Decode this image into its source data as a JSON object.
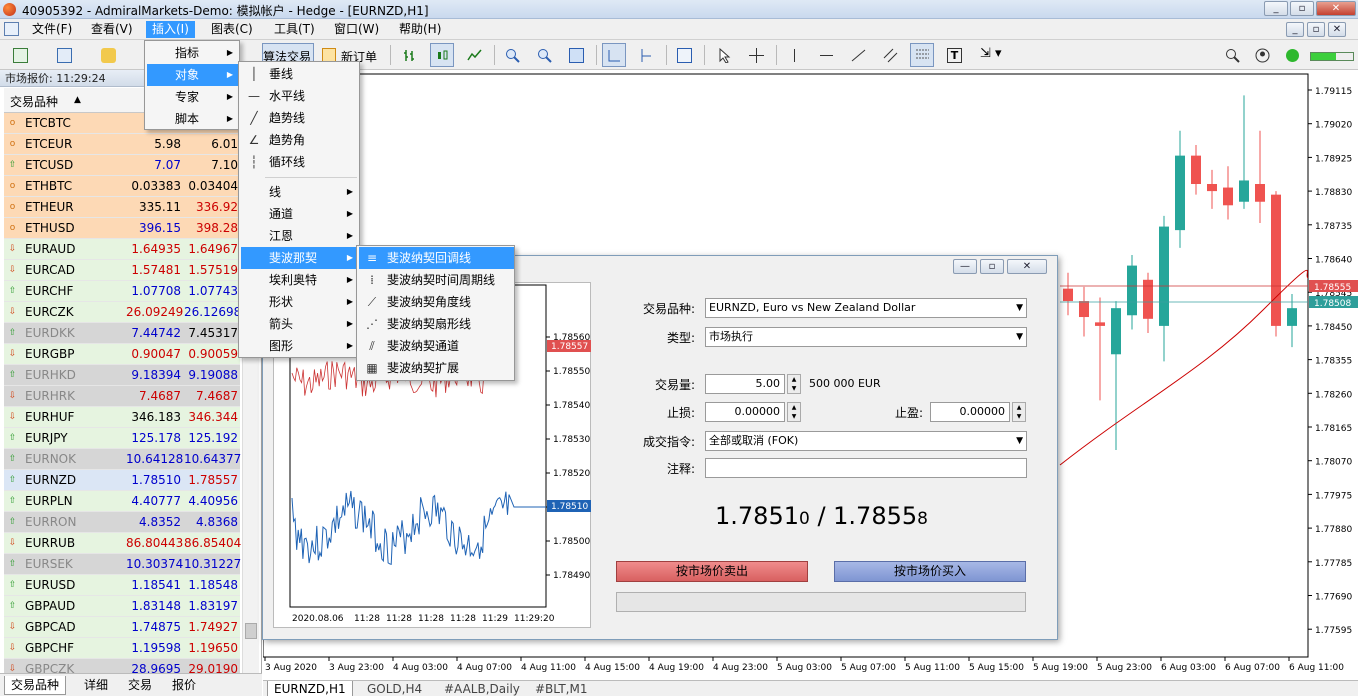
{
  "window": {
    "title": "40905392 - AdmiralMarkets-Demo: 模拟帐户 - Hedge - [EURNZD,H1]",
    "min": "_",
    "restore": "▫",
    "close": "✕"
  },
  "menubar": [
    "文件(F)",
    "查看(V)",
    "插入(I)",
    "图表(C)",
    "工具(T)",
    "窗口(W)",
    "帮助(H)"
  ],
  "toolbar": {
    "algo_label": "算法交易",
    "new_order_label": "新订单"
  },
  "market_watch": {
    "title": "市场报价: 11:29:24",
    "col_symbol": "交易品种",
    "rows": [
      {
        "symbol": "ETCBTC",
        "bid": "0.0",
        "ask": "",
        "bg": "#fdd9b5",
        "dir": "o"
      },
      {
        "symbol": "ETCEUR",
        "bid": "5.98",
        "ask": "6.01",
        "bg": "#fdd9b5",
        "dir": "o"
      },
      {
        "symbol": "ETCUSD",
        "bid": "7.07",
        "ask": "7.10",
        "bg": "#fdd9b5",
        "dir": "up",
        "bidc": "#0000cc"
      },
      {
        "symbol": "ETHBTC",
        "bid": "0.03383",
        "ask": "0.03404",
        "bg": "#fdd9b5",
        "dir": "o"
      },
      {
        "symbol": "ETHEUR",
        "bid": "335.11",
        "ask": "336.92",
        "bg": "#fdd9b5",
        "dir": "o",
        "askc": "#cc0000"
      },
      {
        "symbol": "ETHUSD",
        "bid": "396.15",
        "ask": "398.28",
        "bg": "#fdd9b5",
        "dir": "o",
        "bidc": "#0000cc",
        "askc": "#cc0000"
      },
      {
        "symbol": "EURAUD",
        "bid": "1.64935",
        "ask": "1.64967",
        "bg": "#e6f4e0",
        "dir": "down",
        "bidc": "#cc0000",
        "askc": "#cc0000"
      },
      {
        "symbol": "EURCAD",
        "bid": "1.57481",
        "ask": "1.57519",
        "bg": "#e6f4e0",
        "dir": "down",
        "bidc": "#cc0000",
        "askc": "#cc0000"
      },
      {
        "symbol": "EURCHF",
        "bid": "1.07708",
        "ask": "1.07743",
        "bg": "#e6f4e0",
        "dir": "up",
        "bidc": "#0000cc",
        "askc": "#0000cc"
      },
      {
        "symbol": "EURCZK",
        "bid": "26.09249",
        "ask": "26.12698",
        "bg": "#e6f4e0",
        "dir": "down",
        "bidc": "#cc0000",
        "askc": "#0000cc"
      },
      {
        "symbol": "EURDKK",
        "bid": "7.44742",
        "ask": "7.45317",
        "bg": "#d6d6d6",
        "dir": "up",
        "bidc": "#0000cc",
        "symc": "#888"
      },
      {
        "symbol": "EURGBP",
        "bid": "0.90047",
        "ask": "0.90059",
        "bg": "#e6f4e0",
        "dir": "down",
        "bidc": "#cc0000",
        "askc": "#cc0000"
      },
      {
        "symbol": "EURHKD",
        "bid": "9.18394",
        "ask": "9.19088",
        "bg": "#d6d6d6",
        "dir": "up",
        "bidc": "#0000cc",
        "askc": "#0000cc",
        "symc": "#888"
      },
      {
        "symbol": "EURHRK",
        "bid": "7.4687",
        "ask": "7.4687",
        "bg": "#d6d6d6",
        "dir": "down",
        "bidc": "#cc0000",
        "askc": "#cc0000",
        "symc": "#888"
      },
      {
        "symbol": "EURHUF",
        "bid": "346.183",
        "ask": "346.344",
        "bg": "#e6f4e0",
        "dir": "down",
        "askc": "#cc0000"
      },
      {
        "symbol": "EURJPY",
        "bid": "125.178",
        "ask": "125.192",
        "bg": "#e6f4e0",
        "dir": "up",
        "bidc": "#0000cc",
        "askc": "#0000cc"
      },
      {
        "symbol": "EURNOK",
        "bid": "10.64128",
        "ask": "10.64377",
        "bg": "#d6d6d6",
        "dir": "up",
        "bidc": "#0000cc",
        "askc": "#0000cc",
        "symc": "#888"
      },
      {
        "symbol": "EURNZD",
        "bid": "1.78510",
        "ask": "1.78557",
        "bg": "#dbe6f5",
        "dir": "up",
        "bidc": "#0000cc",
        "askc": "#cc0000"
      },
      {
        "symbol": "EURPLN",
        "bid": "4.40777",
        "ask": "4.40956",
        "bg": "#e6f4e0",
        "dir": "up",
        "bidc": "#0000cc",
        "askc": "#0000cc"
      },
      {
        "symbol": "EURRON",
        "bid": "4.8352",
        "ask": "4.8368",
        "bg": "#d6d6d6",
        "dir": "up",
        "bidc": "#0000cc",
        "askc": "#0000cc",
        "symc": "#888"
      },
      {
        "symbol": "EURRUB",
        "bid": "86.80443",
        "ask": "86.85404",
        "bg": "#e6f4e0",
        "dir": "down",
        "bidc": "#cc0000",
        "askc": "#cc0000"
      },
      {
        "symbol": "EURSEK",
        "bid": "10.30374",
        "ask": "10.31227",
        "bg": "#d6d6d6",
        "dir": "up",
        "bidc": "#0000cc",
        "askc": "#0000cc",
        "symc": "#888"
      },
      {
        "symbol": "EURUSD",
        "bid": "1.18541",
        "ask": "1.18548",
        "bg": "#e6f4e0",
        "dir": "up",
        "bidc": "#0000cc",
        "askc": "#0000cc"
      },
      {
        "symbol": "GBPAUD",
        "bid": "1.83148",
        "ask": "1.83197",
        "bg": "#e6f4e0",
        "dir": "up",
        "bidc": "#0000cc",
        "askc": "#0000cc"
      },
      {
        "symbol": "GBPCAD",
        "bid": "1.74875",
        "ask": "1.74927",
        "bg": "#e6f4e0",
        "dir": "down",
        "bidc": "#0000cc",
        "askc": "#cc0000"
      },
      {
        "symbol": "GBPCHF",
        "bid": "1.19598",
        "ask": "1.19650",
        "bg": "#e6f4e0",
        "dir": "down",
        "bidc": "#0000cc",
        "askc": "#cc0000"
      },
      {
        "symbol": "GBPCZK",
        "bid": "28.9695",
        "ask": "29.0190",
        "bg": "#d6d6d6",
        "dir": "down",
        "bidc": "#0000cc",
        "askc": "#cc0000",
        "symc": "#888"
      }
    ],
    "tabs": [
      "交易品种",
      "详细",
      "交易",
      "报价"
    ]
  },
  "insert_menu": [
    "指标",
    "对象",
    "专家",
    "脚本"
  ],
  "object_menu": {
    "top": [
      "垂线",
      "水平线",
      "趋势线",
      "趋势角",
      "循环线"
    ],
    "sub": [
      "线",
      "通道",
      "江恩",
      "斐波那契",
      "埃利奥特",
      "形状",
      "箭头",
      "图形"
    ]
  },
  "fib_menu": [
    "斐波纳契回调线",
    "斐波纳契时间周期线",
    "斐波纳契角度线",
    "斐波纳契扇形线",
    "斐波纳契通道",
    "斐波纳契扩展"
  ],
  "chart": {
    "price_ticks": [
      "1.79115",
      "1.79020",
      "1.78925",
      "1.78830",
      "1.78735",
      "1.78640",
      "1.78545",
      "1.78450",
      "1.78355",
      "1.78260",
      "1.78165",
      "1.78070",
      "1.77975",
      "1.77880",
      "1.77785",
      "1.77690",
      "1.77595"
    ],
    "time_ticks": [
      "3 Aug 2020",
      "3 Aug 23:00",
      "4 Aug 03:00",
      "4 Aug 07:00",
      "4 Aug 11:00",
      "4 Aug 15:00",
      "4 Aug 19:00",
      "4 Aug 23:00",
      "5 Aug 03:00",
      "5 Aug 07:00",
      "5 Aug 11:00",
      "5 Aug 15:00",
      "5 Aug 19:00",
      "5 Aug 23:00",
      "6 Aug 03:00",
      "6 Aug 07:00",
      "6 Aug 11:00"
    ],
    "ask_label": "1.78555",
    "bid_label": "1.78508",
    "tabs": [
      "EURNZD,H1",
      "GOLD,H4",
      "#AALB,Daily",
      "#BLT,M1"
    ]
  },
  "dialog": {
    "symbol_label": "交易品种:",
    "symbol_value": "EURNZD, Euro vs New Zealand Dollar",
    "type_label": "类型:",
    "type_value": "市场执行",
    "volume_label": "交易量:",
    "volume_value": "5.00",
    "volume_note": "500 000 EUR",
    "sl_label": "止损:",
    "sl_value": "0.00000",
    "tp_label": "止盈:",
    "tp_value": "0.00000",
    "fill_label": "成交指令:",
    "fill_value": "全部或取消 (FOK)",
    "comment_label": "注释:",
    "bid_big": "1.7851",
    "bid_small": "0",
    "sep": " / ",
    "ask_big": "1.7855",
    "ask_small": "8",
    "sell_label": "按市场价卖出",
    "buy_label": "按市场价买入",
    "mini_ticks": [
      "1.78560",
      "1.78550",
      "1.78540",
      "1.78530",
      "1.78520",
      "1.78510",
      "1.78500",
      "1.78490"
    ],
    "mini_ask": "1.78557",
    "mini_bid": "1.78510",
    "mini_time": [
      "2020.08.06",
      "11:28",
      "11:28",
      "11:28",
      "11:28",
      "11:29",
      "11:29:20"
    ]
  }
}
